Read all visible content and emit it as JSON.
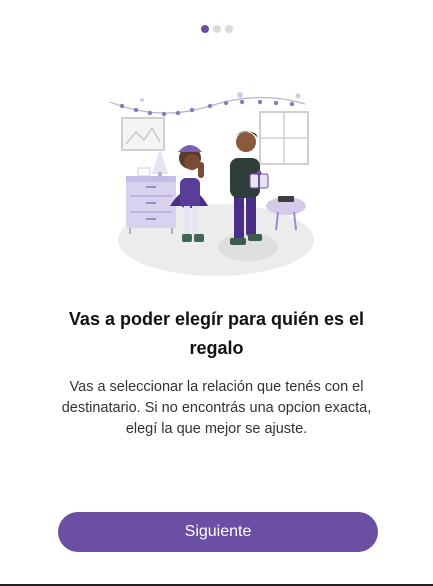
{
  "pager": {
    "total": 3,
    "current": 1,
    "active_color": "#6a4fa3",
    "inactive_color": "#d9d9d9"
  },
  "illustration": {
    "icon": "gift-exchange-illustration",
    "accent_color": "#6a4fa3"
  },
  "content": {
    "title": "Vas a poder elegír para quién es el regalo",
    "description": "Vas a seleccionar la relación que tenés con el destinatario. Si no encontrás una opcion exacta, elegí la que mejor se ajuste."
  },
  "actions": {
    "next_label": "Siguiente",
    "button_color": "#6a4fa3"
  }
}
